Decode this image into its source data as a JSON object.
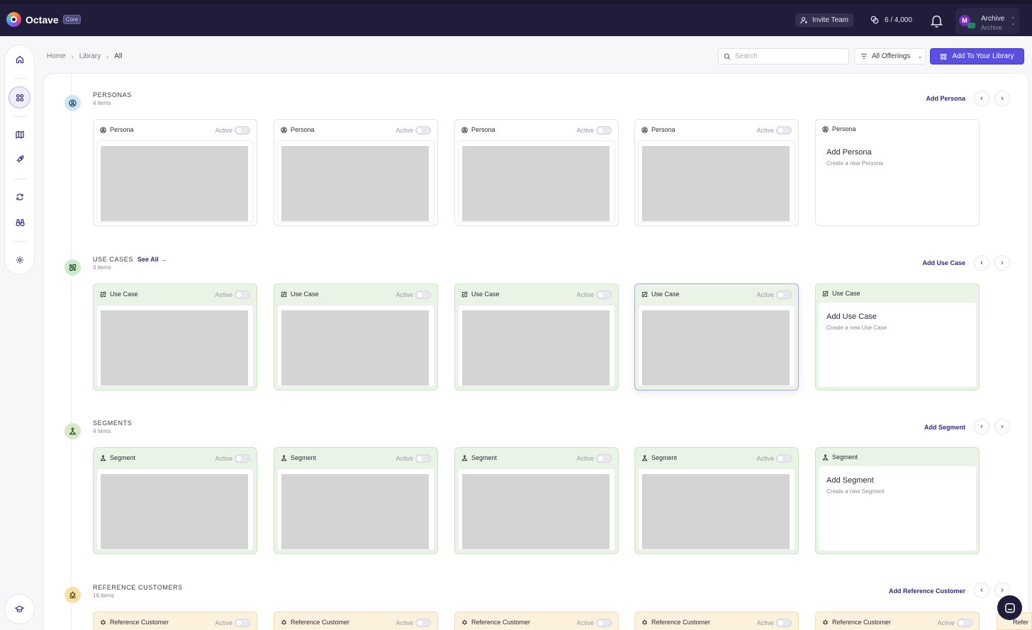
{
  "app": {
    "name": "Octave",
    "badge": "Core"
  },
  "topbar": {
    "invite_label": "Invite Team",
    "credits": "6 / 4,000",
    "account_initial": "M",
    "account_name": "Archive",
    "account_role": "Archive"
  },
  "breadcrumb": [
    "Home",
    "Library",
    "All"
  ],
  "search": {
    "placeholder": "Search",
    "value": ""
  },
  "filter": {
    "selected": "All Offerings"
  },
  "primary_action": "Add To Your Library",
  "colors": {
    "brand_dark": "#1f1d3a",
    "accent": "#5b4fe0",
    "link": "#2d2a7a"
  },
  "sections": {
    "personas": {
      "title": "PERSONAS",
      "count": "4 items",
      "add_label": "Add Persona",
      "see_all": "",
      "cards": [
        {
          "type": "Persona",
          "status": "Active"
        },
        {
          "type": "Persona",
          "status": "Active"
        },
        {
          "type": "Persona",
          "status": "Active"
        },
        {
          "type": "Persona",
          "status": "Active"
        }
      ],
      "add_card": {
        "type": "Persona",
        "title": "Add Persona",
        "subtitle": "Create a new Persona"
      }
    },
    "use_cases": {
      "title": "USE CASES",
      "count": "4 items",
      "add_label": "Add Use Case",
      "see_all": "See All",
      "cards": [
        {
          "type": "Use Case",
          "status": "Active"
        },
        {
          "type": "Use Case",
          "status": "Active"
        },
        {
          "type": "Use Case",
          "status": "Active"
        },
        {
          "type": "Use Case",
          "status": "Active"
        }
      ],
      "add_card": {
        "type": "Use Case",
        "title": "Add Use Case",
        "subtitle": "Create a new Use Case"
      }
    },
    "segments": {
      "title": "SEGMENTS",
      "count": "4 items",
      "add_label": "Add Segment",
      "see_all": "",
      "cards": [
        {
          "type": "Segment",
          "status": "Active"
        },
        {
          "type": "Segment",
          "status": "Active"
        },
        {
          "type": "Segment",
          "status": "Active"
        },
        {
          "type": "Segment",
          "status": "Active"
        }
      ],
      "add_card": {
        "type": "Segment",
        "title": "Add Segment",
        "subtitle": "Create a new Segment"
      }
    },
    "reference_customers": {
      "title": "REFERENCE CUSTOMERS",
      "count": "16 items",
      "add_label": "Add Reference Customer",
      "see_all": "",
      "cards": [
        {
          "type": "Reference Customer",
          "status": "Active"
        },
        {
          "type": "Reference Customer",
          "status": "Active"
        },
        {
          "type": "Reference Customer",
          "status": "Active"
        },
        {
          "type": "Reference Customer",
          "status": "Active"
        },
        {
          "type": "Reference Customer",
          "status": "Active"
        }
      ],
      "overflow_label": "Refer"
    }
  }
}
